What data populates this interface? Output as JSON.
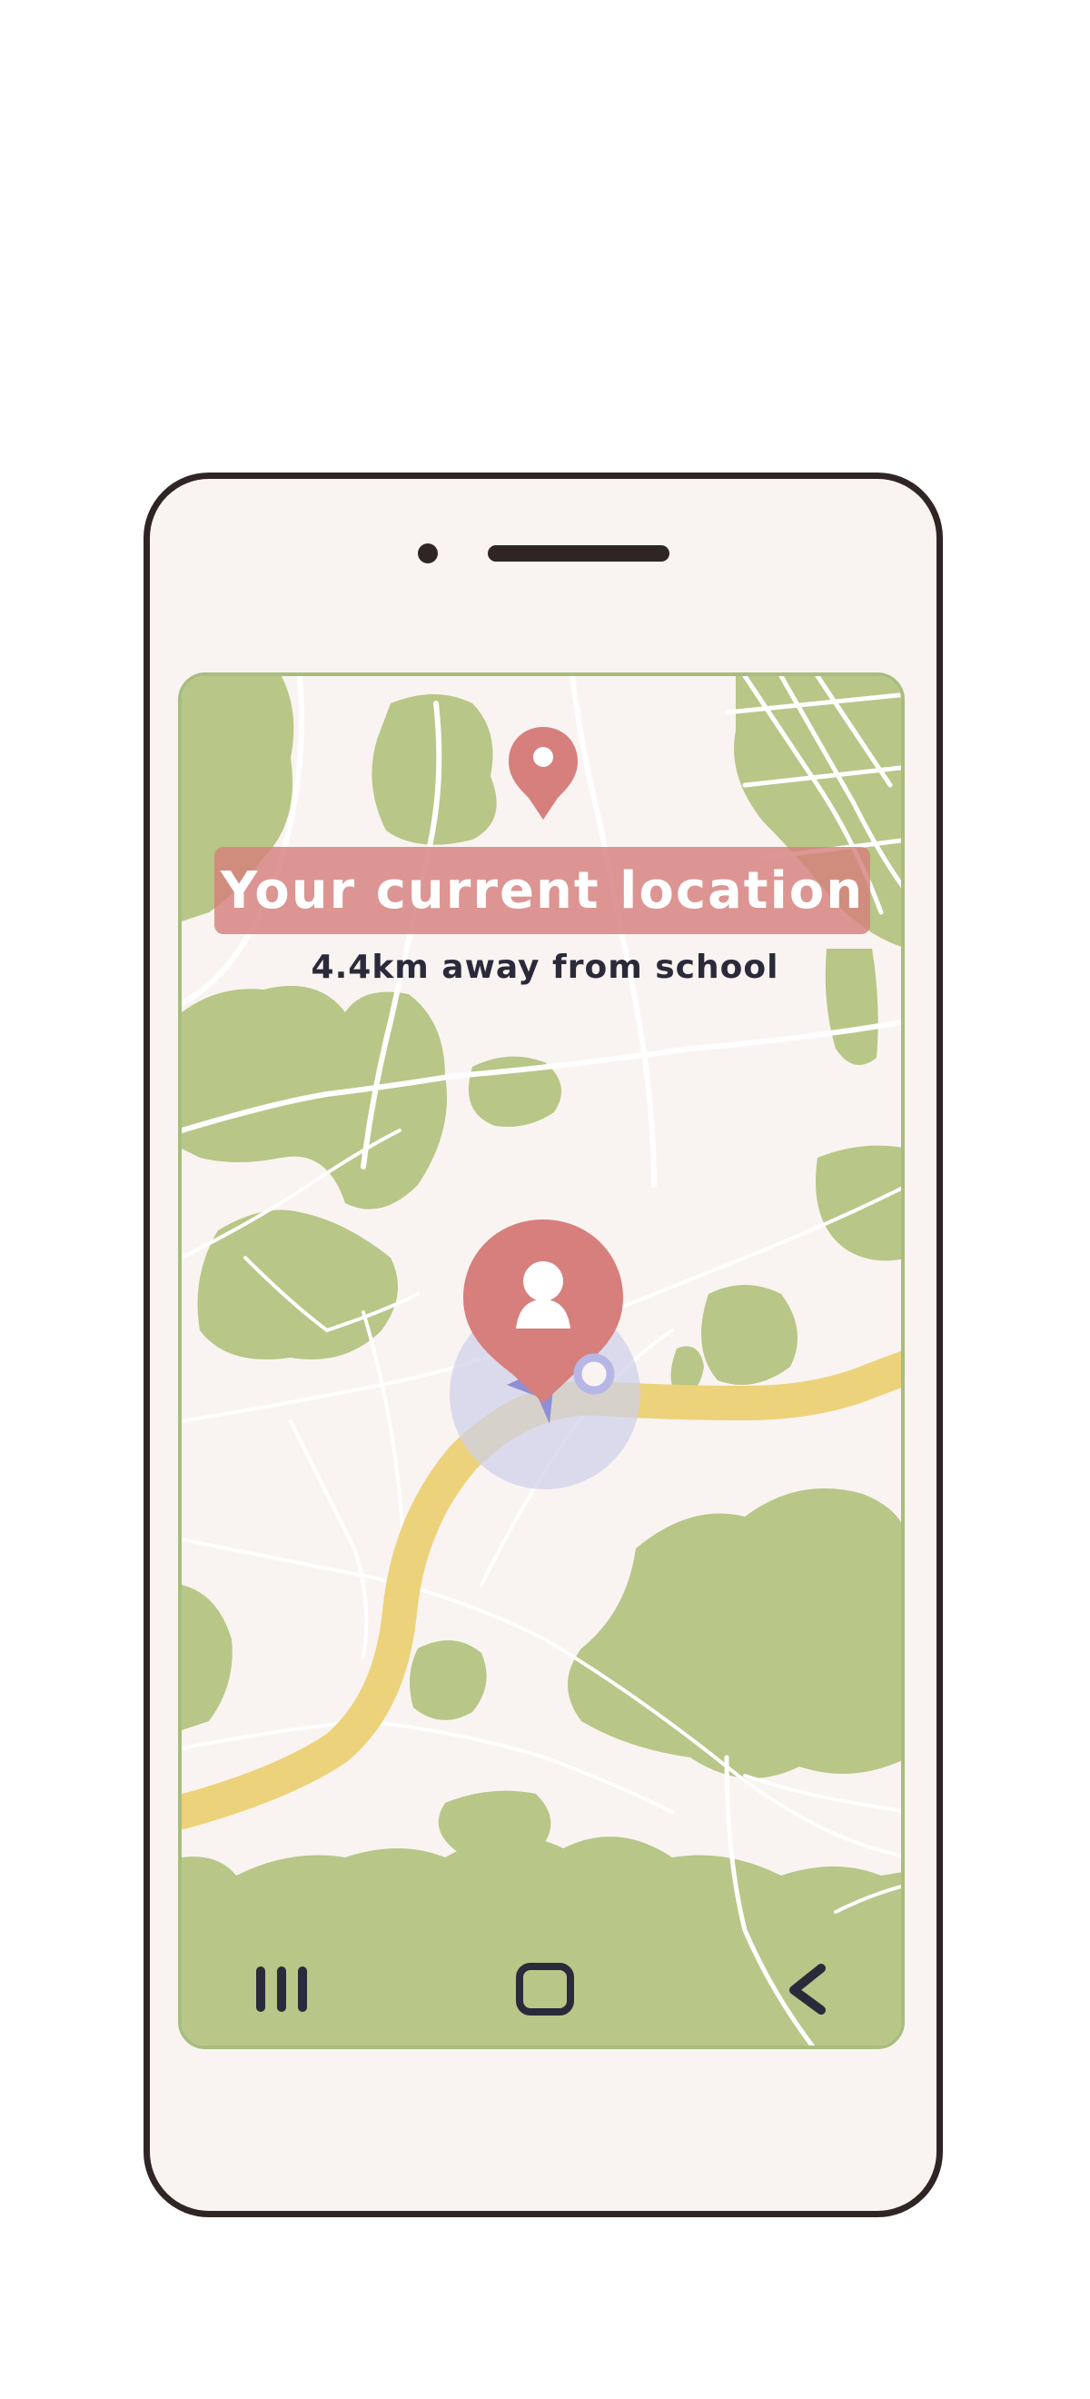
{
  "screen": {
    "banner_title": "Your current location",
    "distance_text": "4.4km away from school"
  },
  "map": {
    "destination_marker": "location-pin-icon",
    "user_marker": "user-pin-icon",
    "heading_marker": "navigation-arrow-icon",
    "colors": {
      "background": "#f9f4f1",
      "park": "#b8c687",
      "road": "#ffffff",
      "route": "#ecd27a",
      "pin": "#d67f7c",
      "accuracy_circle": "#cfd0ec",
      "arrow": "#8f8fd6"
    }
  },
  "nav_bar": {
    "recents_icon": "recents-icon",
    "home_icon": "home-icon",
    "back_icon": "back-icon"
  }
}
